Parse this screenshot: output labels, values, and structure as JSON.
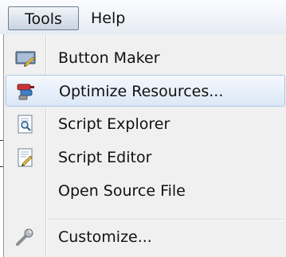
{
  "menubar": {
    "tools_label": "Tools",
    "help_label": "Help"
  },
  "tools_menu": {
    "items": [
      {
        "label": "Button Maker",
        "icon": "button-maker-icon"
      },
      {
        "label": "Optimize Resources...",
        "icon": "optimize-resources-icon",
        "highlighted": true
      },
      {
        "label": "Script Explorer",
        "icon": "script-explorer-icon"
      },
      {
        "label": "Script Editor",
        "icon": "script-editor-icon"
      },
      {
        "label": "Open Source File",
        "icon": ""
      },
      {
        "label": "Customize...",
        "icon": "wrench-icon"
      }
    ]
  },
  "colors": {
    "menu_background": "#f0f0f0",
    "highlight_border": "#a9c5e4",
    "highlight_fill": "#dbe8f6"
  }
}
